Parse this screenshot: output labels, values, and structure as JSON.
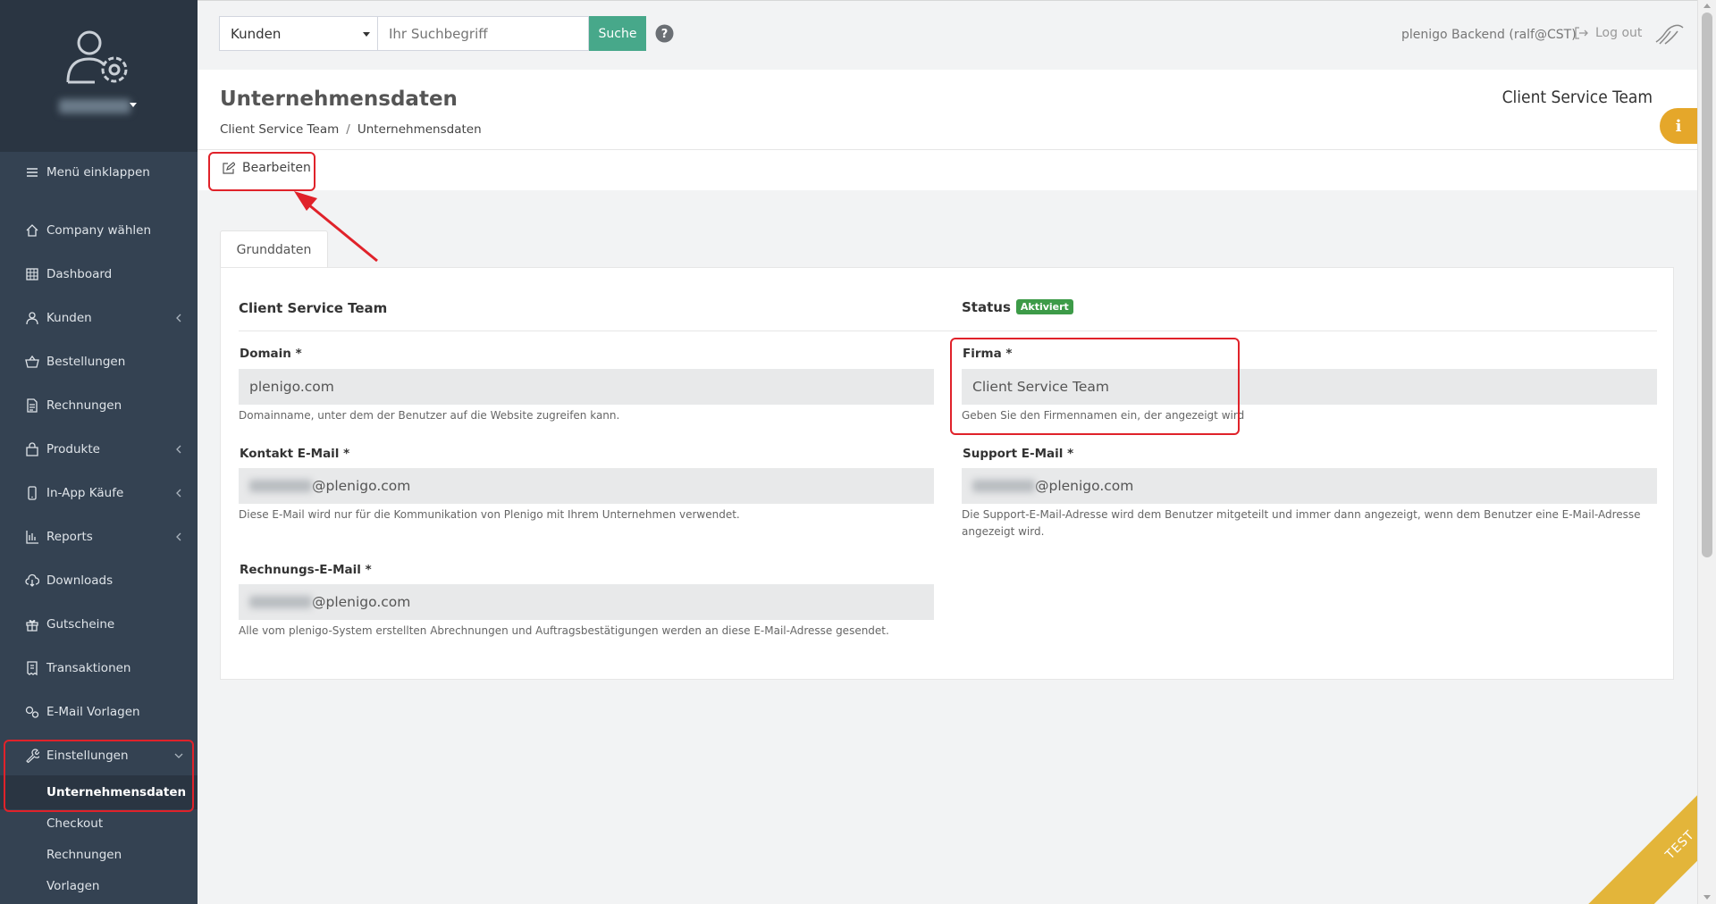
{
  "sidebar": {
    "collapse_label": "Menü einklappen",
    "items": [
      {
        "label": "Company wählen",
        "icon": "home-icon"
      },
      {
        "label": "Dashboard",
        "icon": "grid-icon"
      },
      {
        "label": "Kunden",
        "icon": "user-icon"
      },
      {
        "label": "Bestellungen",
        "icon": "basket-icon"
      },
      {
        "label": "Rechnungen",
        "icon": "document-icon"
      },
      {
        "label": "Produkte",
        "icon": "shopping-bag-icon"
      },
      {
        "label": "In-App Käufe",
        "icon": "mobile-icon"
      },
      {
        "label": "Reports",
        "icon": "bar-chart-icon"
      },
      {
        "label": "Downloads",
        "icon": "cloud-download-icon"
      },
      {
        "label": "Gutscheine",
        "icon": "gift-icon"
      },
      {
        "label": "Transaktionen",
        "icon": "receipt-icon"
      },
      {
        "label": "E-Mail Vorlagen",
        "icon": "settings-gears-icon"
      },
      {
        "label": "Einstellungen",
        "icon": "wrench-icon"
      }
    ],
    "submenu": [
      {
        "label": "Unternehmensdaten"
      },
      {
        "label": "Checkout"
      },
      {
        "label": "Rechnungen"
      },
      {
        "label": "Vorlagen"
      }
    ]
  },
  "topbar": {
    "search_category": "Kunden",
    "search_placeholder": "Ihr Suchbegriff",
    "search_button": "Suche",
    "user_label": "plenigo Backend (ralf@CST)",
    "logout_label": "Log out"
  },
  "page": {
    "title": "Unternehmensdaten",
    "breadcrumb": [
      "Client Service Team",
      "Unternehmensdaten"
    ],
    "company_name_right": "Client Service Team",
    "info_label": "i",
    "edit_button": "Bearbeiten",
    "tab_label": "Grunddaten"
  },
  "card": {
    "left_title": "Client Service Team",
    "status_label": "Status",
    "status_badge": "Aktiviert",
    "fields": {
      "domain": {
        "label": "Domain *",
        "value": "plenigo.com",
        "help": "Domainname, unter dem der Benutzer auf die Website zugreifen kann."
      },
      "firma": {
        "label": "Firma *",
        "value": "Client Service Team",
        "help": "Geben Sie den Firmennamen ein, der angezeigt wird"
      },
      "contact_email": {
        "label": "Kontakt E-Mail *",
        "value": "@plenigo.com",
        "help": "Diese E-Mail wird nur für die Kommunikation von Plenigo mit Ihrem Unternehmen verwendet."
      },
      "support_email": {
        "label": "Support E-Mail *",
        "value": "@plenigo.com",
        "help": "Die Support-E-Mail-Adresse wird dem Benutzer mitgeteilt und immer dann angezeigt, wenn dem Benutzer eine E-Mail-Adresse angezeigt wird."
      },
      "billing_email": {
        "label": "Rechnungs-E-Mail *",
        "value": "@plenigo.com",
        "help": "Alle vom plenigo-System erstellten Abrechnungen und Auftragsbestätigungen werden an diese E-Mail-Adresse gesendet."
      }
    }
  },
  "ribbon": {
    "label": "TEST"
  },
  "colors": {
    "sidebar_bg": "#344252",
    "accent_green": "#47a88a",
    "badge_green": "#3d9b48",
    "info_orange": "#e5a72a",
    "annotation_red": "#e0222a"
  }
}
